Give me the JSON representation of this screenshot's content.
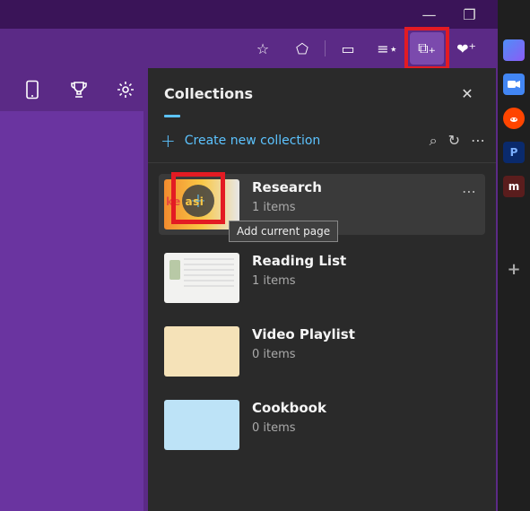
{
  "window": {
    "min": "—",
    "restore": "❐",
    "close": "✕"
  },
  "toolbar": {
    "favorite": "☆",
    "extensions": "⬠",
    "split": "▭",
    "favorites_hub": "≡⋆",
    "collections": "⧉₊",
    "heart": "❤⁺",
    "more": "⋯"
  },
  "subbar": {
    "mobile": "📱",
    "trophy": "🏆",
    "settings": "⚙"
  },
  "panel": {
    "title": "Collections",
    "close": "✕",
    "create_label": "Create new collection",
    "search": "⌕",
    "refresh": "↻",
    "more": "⋯",
    "tooltip": "Add current page",
    "items": [
      {
        "name": "Research",
        "count": "1 items"
      },
      {
        "name": "Reading List",
        "count": "1 items"
      },
      {
        "name": "Video Playlist",
        "count": "0 items"
      },
      {
        "name": "Cookbook",
        "count": "0 items"
      }
    ],
    "item_more": "⋯",
    "add_plus": "+"
  },
  "sidebar": {
    "cam": "📷",
    "reddit": "●",
    "pp": "P",
    "m": "m",
    "plus": "+"
  }
}
